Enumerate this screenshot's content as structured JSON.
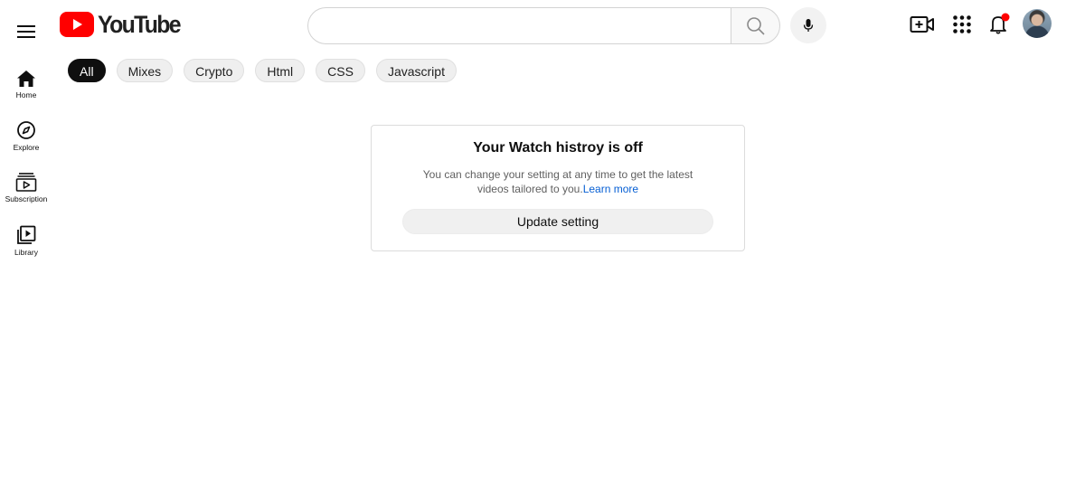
{
  "app": {
    "logo_text": "YouTube"
  },
  "search": {
    "placeholder": ""
  },
  "chips": [
    "All",
    "Mixes",
    "Crypto",
    "Html",
    "CSS",
    "Javascript"
  ],
  "sidebar": {
    "items": [
      {
        "label": "Home",
        "icon": "home-icon"
      },
      {
        "label": "Explore",
        "icon": "compass-icon"
      },
      {
        "label": "Subscription",
        "icon": "subscriptions-icon"
      },
      {
        "label": "Library",
        "icon": "library-icon"
      }
    ]
  },
  "card": {
    "title": "Your Watch histroy is off",
    "description": "You can change your setting at any time to get the latest videos tailored to you.",
    "link": "Learn more",
    "button": "Update setting"
  },
  "colors": {
    "brand_red": "#ff0000",
    "link_blue": "#065fd4",
    "notification_dot": "#ff0000"
  }
}
